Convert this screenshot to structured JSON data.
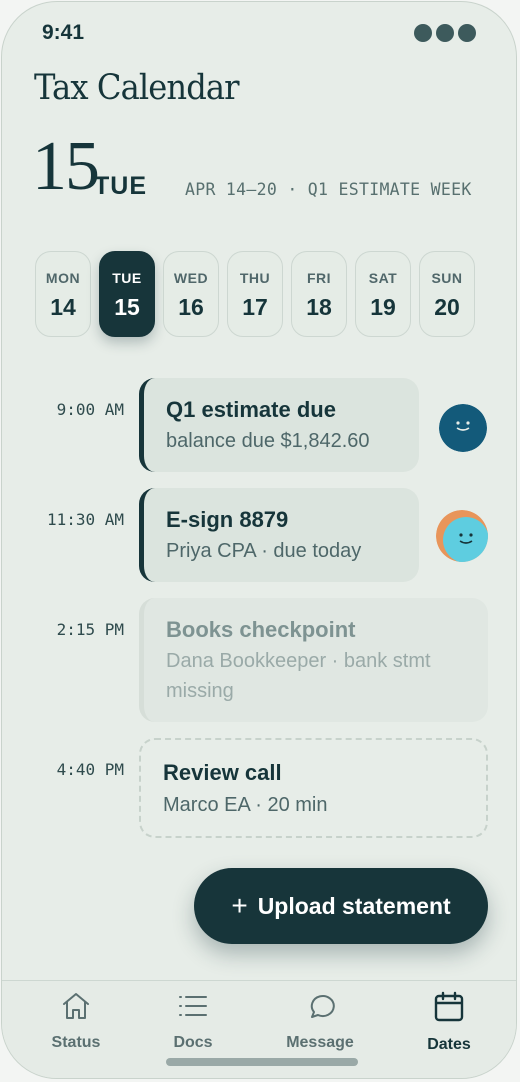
{
  "status_bar": {
    "time": "9:41"
  },
  "header": {
    "title": "Tax Calendar",
    "day_number": "15",
    "day_name": "TUE",
    "week_range": "APR 14–20 · Q1 ESTIMATE WEEK"
  },
  "week": [
    {
      "dow": "MON",
      "dom": "14",
      "selected": false
    },
    {
      "dow": "TUE",
      "dom": "15",
      "selected": true
    },
    {
      "dow": "WED",
      "dom": "16",
      "selected": false
    },
    {
      "dow": "THU",
      "dom": "17",
      "selected": false
    },
    {
      "dow": "FRI",
      "dom": "18",
      "selected": false
    },
    {
      "dow": "SAT",
      "dom": "19",
      "selected": false
    },
    {
      "dow": "SUN",
      "dom": "20",
      "selected": false
    }
  ],
  "events": [
    {
      "time": "9:00 AM",
      "title": "Q1 estimate due",
      "subtitle": "balance due $1,842.60",
      "avatar": "navy-smiley-avatar"
    },
    {
      "time": "11:30 AM",
      "title": "E-sign 8879",
      "subtitle": "Priya CPA · due today",
      "avatar": "cyan-orange-smiley-avatar"
    },
    {
      "time": "2:15 PM",
      "title": "Books checkpoint",
      "subtitle_line1": "Dana Bookkeeper · bank stmt",
      "subtitle_line2": "missing"
    },
    {
      "time": "4:40 PM",
      "title": "Review call",
      "subtitle": "Marco EA · 20 min"
    }
  ],
  "upload_button": {
    "icon": "+",
    "label": "Upload statement"
  },
  "tabs": [
    {
      "label": "Status",
      "icon": "home-icon"
    },
    {
      "label": "Docs",
      "icon": "list-icon"
    },
    {
      "label": "Message",
      "icon": "chat-bubble-icon"
    },
    {
      "label": "Dates",
      "icon": "calendar-icon",
      "active": true
    }
  ],
  "colors": {
    "background": "#e7ede8",
    "primary": "#17353a",
    "card": "#dbe4de",
    "muted_text": "#4e6769",
    "avatar_navy": "#135a7a",
    "avatar_cyan": "#5ecde0",
    "avatar_orange": "#e8955a"
  }
}
